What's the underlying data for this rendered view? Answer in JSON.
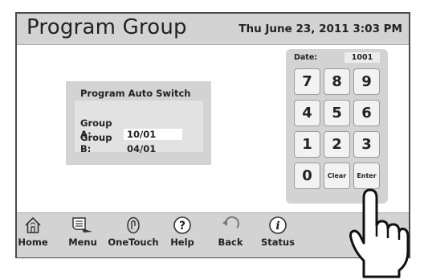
{
  "header": {
    "title": "Program Group",
    "datetime": "Thu June 23, 2011  3:03 PM"
  },
  "panel": {
    "title": "Program Auto Switch",
    "group_a": {
      "label": "Group A:",
      "value": "10/01"
    },
    "group_b": {
      "label": "Group B:",
      "value": "04/01"
    }
  },
  "keypad": {
    "date_label": "Date:",
    "date_value": "1001",
    "keys": [
      "7",
      "8",
      "9",
      "4",
      "5",
      "6",
      "1",
      "2",
      "3",
      "0",
      "Clear",
      "Enter"
    ]
  },
  "navbar": {
    "items": [
      {
        "label": "Home",
        "icon": "home-icon"
      },
      {
        "label": "Menu",
        "icon": "menu-icon"
      },
      {
        "label": "OneTouch",
        "icon": "onetouch-icon"
      },
      {
        "label": "Help",
        "icon": "help-icon"
      },
      {
        "label": "Back",
        "icon": "back-icon"
      },
      {
        "label": "Status",
        "icon": "status-icon"
      }
    ]
  },
  "colors": {
    "bar_gray": "#d3d3d3",
    "key_face": "#f2f2f2",
    "text": "#222222"
  }
}
